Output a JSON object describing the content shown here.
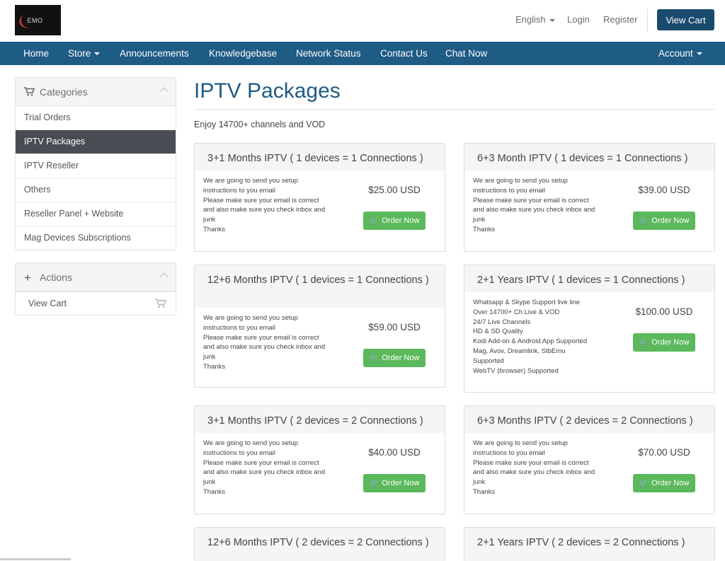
{
  "brand": {
    "logo_text": "EMO"
  },
  "header": {
    "language": "English",
    "login": "Login",
    "register": "Register",
    "view_cart": "View Cart"
  },
  "nav": {
    "home": "Home",
    "store": "Store",
    "announcements": "Announcements",
    "knowledgebase": "Knowledgebase",
    "network_status": "Network Status",
    "contact_us": "Contact Us",
    "chat_now": "Chat Now",
    "account": "Account"
  },
  "sidebar": {
    "categories_title": "Categories",
    "items": [
      "Trial Orders",
      "IPTV Packages",
      "IPTV Reseller",
      "Others",
      "Reseller Panel + Website",
      "Mag Devices Subscriptions"
    ],
    "actions_title": "Actions",
    "view_cart": "View Cart"
  },
  "main": {
    "title": "IPTV Packages",
    "tagline": "Enjoy 14700+ channels and VOD",
    "order_label": "Order Now",
    "products": [
      {
        "name": "3+1 Months IPTV ( 1 devices = 1 Connections )",
        "price": "$25.00 USD",
        "desc": "We are going to send you setup\ninstructions to you email\nPlease make sure your email is correct\nand also make sure you check inbox and\njunk\nThanks"
      },
      {
        "name": "6+3 Month IPTV ( 1 devices = 1 Connections )",
        "price": "$39.00 USD",
        "desc": "We are going to send you setup\ninstructions to you email\nPlease make sure your email is correct\nand also make sure you check inbox and\njunk\nThanks"
      },
      {
        "name": "12+6 Months IPTV ( 1 devices = 1 Connections )",
        "price": "$59.00 USD",
        "desc": "We are going to send you setup\ninstructions to you email\nPlease make sure your email is correct\nand also make sure you check inbox and\njunk\nThanks"
      },
      {
        "name": "2+1 Years IPTV ( 1 devices = 1 Connections )",
        "price": "$100.00 USD",
        "desc": "Whatsapp & Skype Support live line\nOver 14700+ Ch Live & VOD\n24/7 Live Channels\nHD & SD Quality\nKodi Add-on & Android App Supported\nMag, Avov, Dreamlink, StbEmu\nSupported\nWebTV (browser) Supported"
      },
      {
        "name": "3+1 Months IPTV ( 2 devices = 2 Connections )",
        "price": "$40.00 USD",
        "desc": "We are going to send you setup\ninstructions to you email\nPlease make sure your email is correct\nand also make sure you check inbox and\njunk\nThanks"
      },
      {
        "name": "6+3 Months IPTV ( 2 devices = 2 Connections )",
        "price": "$70.00 USD",
        "desc": "We are going to send you setup\ninstructions to you email\nPlease make sure your email is correct\nand also make sure you check inbox and\njunk\nThanks"
      },
      {
        "name": "12+6 Months IPTV ( 2 devices = 2 Connections )",
        "price": "",
        "desc": ""
      },
      {
        "name": "2+1 Years IPTV ( 2 devices = 2 Connections )",
        "price": "",
        "desc": ""
      }
    ]
  },
  "colors": {
    "brand_blue": "#1e5b85",
    "button_dark": "#1a4b6e",
    "order_green": "#5cb85c",
    "active_item": "#474d52"
  },
  "icons": [
    "cart-icon",
    "plus-icon",
    "chevron-up-icon",
    "caret-down-icon"
  ]
}
